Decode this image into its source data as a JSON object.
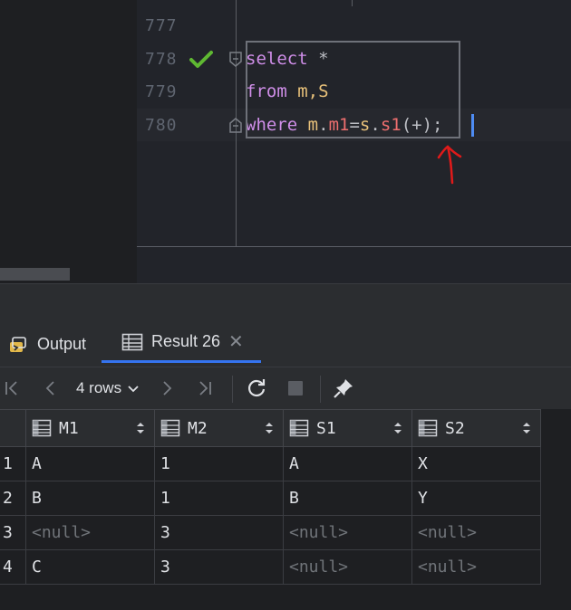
{
  "editor": {
    "lines": [
      {
        "number": "777",
        "code": ""
      },
      {
        "number": "778",
        "code": "select *"
      },
      {
        "number": "779",
        "code": "from m,S"
      },
      {
        "number": "780",
        "code": "where m.m1=s.s1(+);"
      }
    ],
    "tokens": {
      "select": "select",
      "star": " *",
      "from": "from",
      "from_rest": " m,S",
      "where": "where",
      "sp": " ",
      "m_alias": "m",
      "dot1": ".",
      "m1": "m1",
      "eq": "=",
      "s_alias": "s",
      "dot2": ".",
      "s1": "s1",
      "plus": "(+)",
      "semi": ";"
    },
    "colors": {
      "keyword": "#cf8ee8",
      "alias": "#e8c17a",
      "column": "#ef6f6f",
      "check": "#5fb832",
      "annotation": "#e01a1a"
    },
    "run_status_icon": "check-icon"
  },
  "tabs": [
    {
      "label": "Output",
      "icon": "output-icon",
      "active": false
    },
    {
      "label": "Result 26",
      "icon": "table-icon",
      "active": true,
      "close": "✕"
    }
  ],
  "toolbar": {
    "rows_label": "4 rows",
    "buttons": [
      "first-page-icon",
      "prev-page-icon",
      "next-page-icon",
      "last-page-icon",
      "refresh-icon",
      "stop-icon",
      "pin-icon"
    ]
  },
  "grid": {
    "columns": [
      "M1",
      "M2",
      "S1",
      "S2"
    ],
    "rows": [
      {
        "n": "1",
        "cells": [
          "A",
          "1",
          "A",
          "X"
        ]
      },
      {
        "n": "2",
        "cells": [
          "B",
          "1",
          "B",
          "Y"
        ]
      },
      {
        "n": "3",
        "cells": [
          "<null>",
          "3",
          "<null>",
          "<null>"
        ]
      },
      {
        "n": "4",
        "cells": [
          "C",
          "3",
          "<null>",
          "<null>"
        ]
      }
    ]
  }
}
